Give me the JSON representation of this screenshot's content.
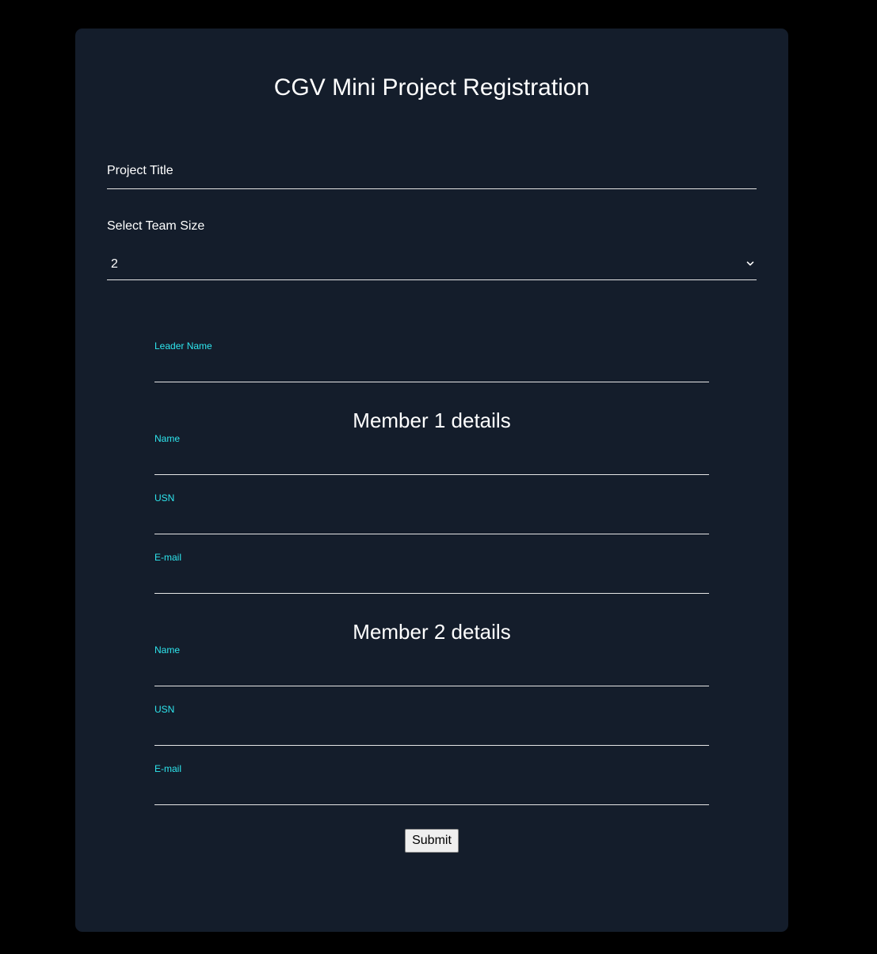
{
  "page": {
    "title": "CGV Mini Project Registration"
  },
  "form": {
    "project_title_label": "Project Title",
    "team_size_label": "Select Team Size",
    "team_size_value": "2",
    "leader_name_label": "Leader Name",
    "members": [
      {
        "heading": "Member 1 details",
        "name_label": "Name",
        "usn_label": "USN",
        "email_label": "E-mail"
      },
      {
        "heading": "Member 2 details",
        "name_label": "Name",
        "usn_label": "USN",
        "email_label": "E-mail"
      }
    ],
    "submit_label": "Submit"
  },
  "colors": {
    "page_background": "#000000",
    "card_background": "#141d2b",
    "label_accent": "#2ee6ee",
    "text": "#ffffff",
    "underline": "#e6e6e6"
  },
  "icons": {
    "select_arrow": "chevron-down-icon"
  }
}
